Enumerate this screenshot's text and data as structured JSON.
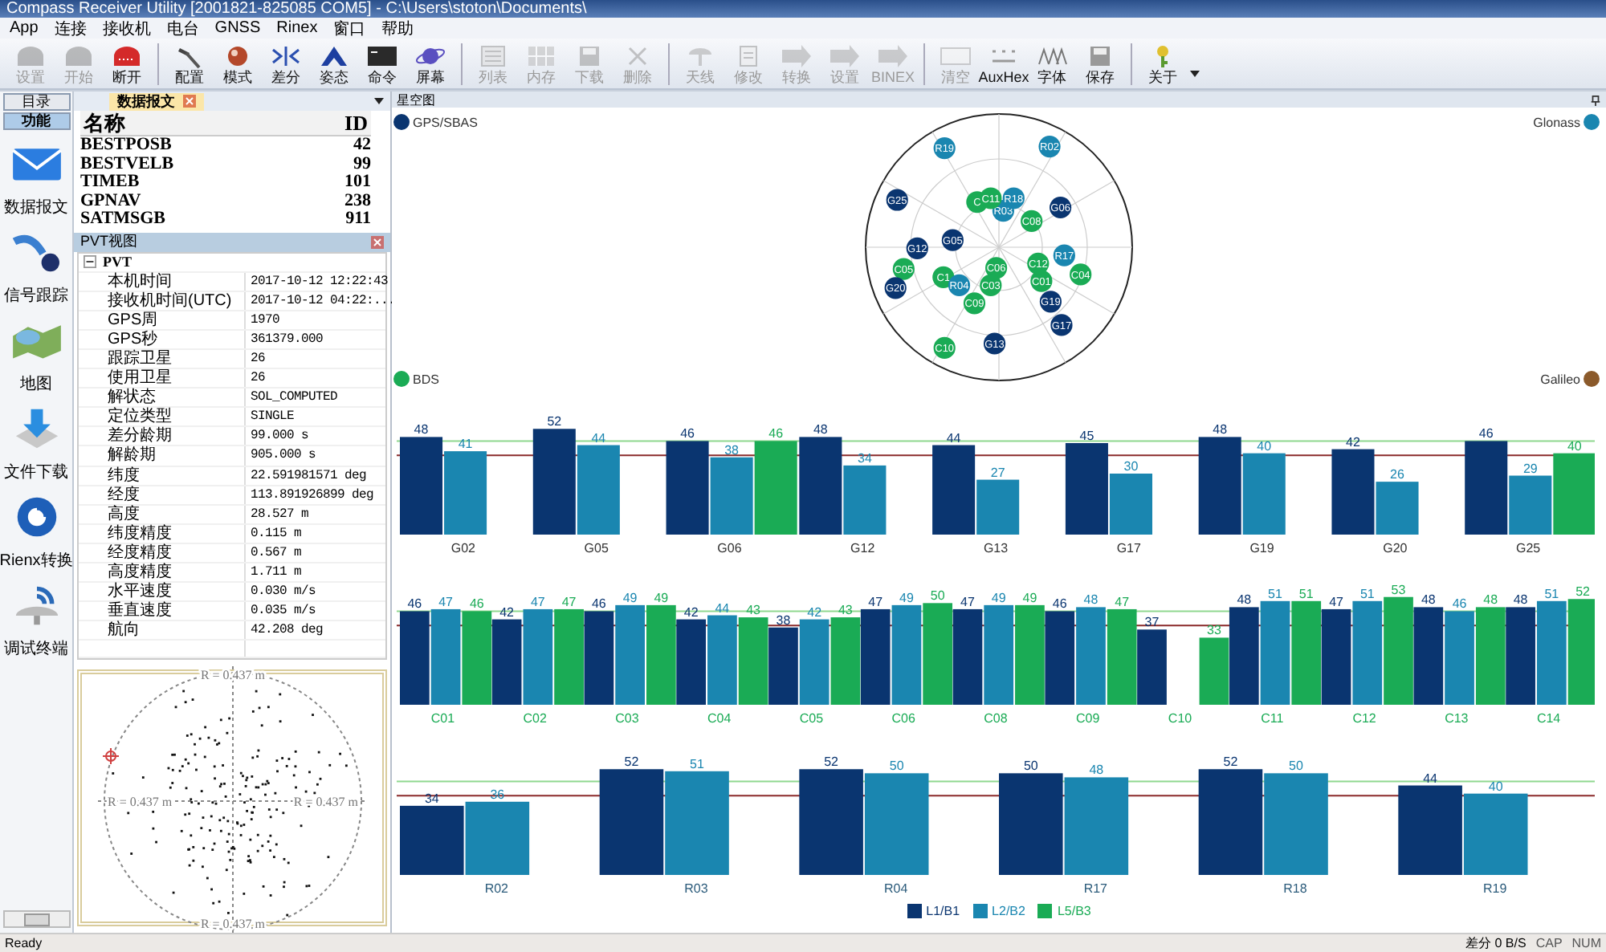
{
  "window": {
    "title": "Compass Receiver Utility [2001821-825085 COM5] - C:\\Users\\stoton\\Documents\\"
  },
  "menu": [
    "App",
    "连接",
    "接收机",
    "电台",
    "GNSS",
    "Rinex",
    "窗口",
    "帮助"
  ],
  "toolbar": [
    {
      "buttons": [
        {
          "label": "设置",
          "disabled": true
        },
        {
          "label": "开始",
          "disabled": true
        },
        {
          "label": "断开",
          "disabled": false
        }
      ]
    },
    {
      "buttons": [
        {
          "label": "配置",
          "disabled": false
        },
        {
          "label": "模式",
          "disabled": false
        },
        {
          "label": "差分",
          "disabled": false
        },
        {
          "label": "姿态",
          "disabled": false
        },
        {
          "label": "命令",
          "disabled": false
        },
        {
          "label": "屏幕",
          "disabled": false
        }
      ]
    },
    {
      "buttons": [
        {
          "label": "列表",
          "disabled": true
        },
        {
          "label": "内存",
          "disabled": true
        },
        {
          "label": "下载",
          "disabled": true
        },
        {
          "label": "删除",
          "disabled": true
        }
      ]
    },
    {
      "buttons": [
        {
          "label": "天线",
          "disabled": true
        },
        {
          "label": "修改",
          "disabled": true
        },
        {
          "label": "转换",
          "disabled": true
        },
        {
          "label": "设置",
          "disabled": true
        },
        {
          "label": "BINEX",
          "disabled": true
        }
      ]
    },
    {
      "buttons": [
        {
          "label": "清空",
          "disabled": true
        },
        {
          "label": "AuxHex",
          "disabled": false
        },
        {
          "label": "字体",
          "disabled": false
        },
        {
          "label": "保存",
          "disabled": false
        }
      ]
    },
    {
      "buttons": [
        {
          "label": "关于",
          "disabled": false
        }
      ]
    }
  ],
  "nav_tabs": [
    {
      "label": "目录",
      "selected": false
    },
    {
      "label": "功能",
      "selected": true
    }
  ],
  "nav_items": [
    {
      "label": "数据报文"
    },
    {
      "label": "信号跟踪"
    },
    {
      "label": "地图"
    },
    {
      "label": "文件下载"
    },
    {
      "label": "Rienx转换"
    },
    {
      "label": "调试终端"
    }
  ],
  "messages": {
    "tab": "数据报文",
    "columns": [
      "名称",
      "ID"
    ],
    "rows": [
      [
        "BESTPOSB",
        "42"
      ],
      [
        "BESTVELB",
        "99"
      ],
      [
        "TIMEB",
        "101"
      ],
      [
        "GPNAV",
        "238"
      ],
      [
        "SATMSGB",
        "911"
      ]
    ]
  },
  "pvt": {
    "title": "PVT视图",
    "root": {
      "label": "PVT",
      "expanded": true,
      "children": [
        {
          "name": "本机时间",
          "value": "2017-10-12 12:22:43"
        },
        {
          "name": "接收机时间(UTC)",
          "value": "2017-10-12 04:22:..."
        },
        {
          "name": "GPS周",
          "value": "1970"
        },
        {
          "name": "GPS秒",
          "value": "361379.000"
        },
        {
          "name": "跟踪卫星",
          "value": "26"
        },
        {
          "name": "使用卫星",
          "value": "26"
        },
        {
          "name": "解状态",
          "value": "SOL_COMPUTED"
        },
        {
          "name": "定位类型",
          "value": "SINGLE"
        },
        {
          "name": "差分龄期",
          "value": "99.000 s"
        },
        {
          "name": "解龄期",
          "value": "905.000 s"
        },
        {
          "name": "纬度",
          "value": "22.591981571 deg"
        },
        {
          "name": "经度",
          "value": "113.891926899 deg"
        },
        {
          "name": "高度",
          "value": "28.527 m"
        },
        {
          "name": "纬度精度",
          "value": "0.115 m"
        },
        {
          "name": "经度精度",
          "value": "0.567 m"
        },
        {
          "name": "高度精度",
          "value": "1.711 m"
        },
        {
          "name": "水平速度",
          "value": "0.030 m/s"
        },
        {
          "name": "垂直速度",
          "value": "0.035 m/s"
        },
        {
          "name": "航向",
          "value": "42.208 deg"
        }
      ]
    }
  },
  "scatter": {
    "radius_labels": [
      "R = 0.437 m",
      "R = 0.437 m",
      "R = 0.437 m",
      "R = 0.437 m"
    ]
  },
  "sky_panel": {
    "title": "星空图",
    "systems": [
      {
        "kind": "gps",
        "label": "GPS/SBAS",
        "color": "#0a3570"
      },
      {
        "kind": "glonass",
        "label": "Glonass",
        "color": "#1a86b0"
      },
      {
        "kind": "bds",
        "label": "BDS",
        "color": "#1aab55"
      },
      {
        "kind": "galileo",
        "label": "Galileo",
        "color": "#8b5a2b"
      }
    ],
    "satellites": [
      {
        "label": "R19",
        "kind": "glonass"
      },
      {
        "label": "R02",
        "kind": "glonass"
      },
      {
        "label": "G25",
        "kind": "gps"
      },
      {
        "label": "G06",
        "kind": "gps"
      },
      {
        "label": "R03",
        "kind": "glonass"
      },
      {
        "label": "C",
        "kind": "bds"
      },
      {
        "label": "C11",
        "kind": "bds"
      },
      {
        "label": "R18",
        "kind": "glonass"
      },
      {
        "label": "C08",
        "kind": "bds"
      },
      {
        "label": "G05",
        "kind": "gps"
      },
      {
        "label": "G12",
        "kind": "gps"
      },
      {
        "label": "C05",
        "kind": "bds"
      },
      {
        "label": "G20",
        "kind": "gps"
      },
      {
        "label": "C1",
        "kind": "bds"
      },
      {
        "label": "R04",
        "kind": "glonass"
      },
      {
        "label": "C06",
        "kind": "bds"
      },
      {
        "label": "C03",
        "kind": "bds"
      },
      {
        "label": "C09",
        "kind": "bds"
      },
      {
        "label": "C01",
        "kind": "bds"
      },
      {
        "label": "G19",
        "kind": "gps"
      },
      {
        "label": "C12",
        "kind": "bds"
      },
      {
        "label": "R17",
        "kind": "glonass"
      },
      {
        "label": "C04",
        "kind": "bds"
      },
      {
        "label": "G17",
        "kind": "gps"
      },
      {
        "label": "C10",
        "kind": "bds"
      },
      {
        "label": "G13",
        "kind": "gps"
      }
    ]
  },
  "signal_charts": [
    {
      "chart_data": {
        "type": "bar",
        "categories": [
          "G02",
          "G05",
          "G06",
          "G12",
          "G13",
          "G17",
          "G19",
          "G20",
          "G25"
        ],
        "data_labels": true,
        "series": [
          {
            "color": "#0a3570",
            "values": [
              48,
              52,
              46,
              48,
              44,
              45,
              48,
              42,
              46
            ]
          },
          {
            "color": "#1a86b0",
            "values": [
              41,
              44,
              38,
              34,
              27,
              30,
              40,
              26,
              29
            ]
          },
          {
            "color": "#1aab55",
            "values": [
              null,
              null,
              46,
              null,
              null,
              null,
              null,
              null,
              40
            ]
          }
        ]
      }
    },
    {
      "chart_data": {
        "type": "bar",
        "categories": [
          "C01",
          "C02",
          "C03",
          "C04",
          "C05",
          "C06",
          "C08",
          "C09",
          "C10",
          "C11",
          "C12",
          "C13",
          "C14"
        ],
        "data_labels": true,
        "series": [
          {
            "color": "#0a3570",
            "values": [
              46,
              42,
              46,
              42,
              38,
              47,
              47,
              46,
              37,
              48,
              47,
              48,
              48
            ]
          },
          {
            "color": "#1a86b0",
            "values": [
              47,
              47,
              49,
              44,
              42,
              49,
              49,
              48,
              null,
              51,
              51,
              46,
              51
            ]
          },
          {
            "color": "#1aab55",
            "values": [
              46,
              47,
              49,
              43,
              43,
              50,
              49,
              47,
              33,
              51,
              53,
              48,
              52
            ]
          }
        ]
      }
    },
    {
      "chart_data": {
        "type": "bar",
        "categories": [
          "R02",
          "R03",
          "R04",
          "R17",
          "R18",
          "R19"
        ],
        "data_labels": true,
        "series": [
          {
            "color": "#0a3570",
            "values": [
              34,
              52,
              52,
              50,
              52,
              44
            ]
          },
          {
            "color": "#1a86b0",
            "values": [
              36,
              51,
              50,
              48,
              50,
              40
            ]
          }
        ]
      }
    }
  ],
  "legend": [
    {
      "label": "L1/B1",
      "color": "#0a3570"
    },
    {
      "label": "L2/B2",
      "color": "#1a86b0"
    },
    {
      "label": "L5/B3",
      "color": "#1aab55"
    }
  ],
  "status_bar": {
    "text": "Ready",
    "rate": "差分 0 B/S",
    "indicators": [
      "CAP",
      "NUM"
    ]
  }
}
